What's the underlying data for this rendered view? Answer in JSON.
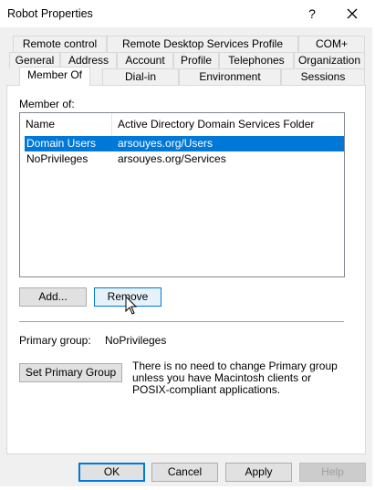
{
  "window": {
    "title": "Robot Properties",
    "help": "?",
    "close_icon": "close-icon",
    "cursor_icon": "mouse-pointer-icon"
  },
  "tabs": {
    "row1": [
      {
        "label": "Remote control"
      },
      {
        "label": "Remote Desktop Services Profile"
      },
      {
        "label": "COM+"
      }
    ],
    "row2": [
      {
        "label": "General"
      },
      {
        "label": "Address"
      },
      {
        "label": "Account"
      },
      {
        "label": "Profile"
      },
      {
        "label": "Telephones"
      },
      {
        "label": "Organization"
      }
    ],
    "row3": [
      {
        "label": "Member Of"
      },
      {
        "label": "Dial-in"
      },
      {
        "label": "Environment"
      },
      {
        "label": "Sessions"
      }
    ],
    "selected": "Member Of"
  },
  "member_of": {
    "label": "Member of:",
    "columns": [
      "Name",
      "Active Directory Domain Services Folder"
    ],
    "rows": [
      {
        "name": "Domain Users",
        "folder": "arsouyes.org/Users",
        "selected": true
      },
      {
        "name": "NoPrivileges",
        "folder": "arsouyes.org/Services",
        "selected": false
      }
    ]
  },
  "buttons": {
    "add": "Add...",
    "remove": "Remove",
    "set_primary": "Set Primary Group"
  },
  "primary_group": {
    "label": "Primary group:",
    "value": "NoPrivileges",
    "note": "There is no need to change Primary group unless you have Macintosh clients or POSIX-compliant applications."
  },
  "footer": {
    "ok": "OK",
    "cancel": "Cancel",
    "apply": "Apply",
    "help": "Help"
  },
  "colors": {
    "selection": "#0078d7",
    "background": "#f0f0f0",
    "panel": "#ffffff"
  }
}
